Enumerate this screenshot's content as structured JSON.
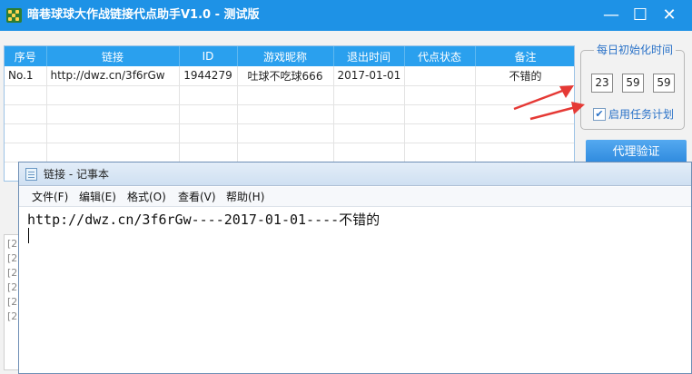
{
  "app": {
    "title": "暗巷球球大作战链接代点助手V1.0 - 测试版",
    "controls": {
      "minimize": "—",
      "maximize": "☐",
      "close": "✕"
    }
  },
  "table": {
    "columns": [
      "序号",
      "链接",
      "ID",
      "游戏昵称",
      "退出时间",
      "代点状态",
      "备注"
    ],
    "rows": [
      [
        "No.1",
        "http://dwz.cn/3f6rGw",
        "1944279",
        "吐球不吃球666",
        "2017-01-01",
        "",
        "不错的"
      ]
    ]
  },
  "init_time": {
    "title": "每日初始化时间",
    "hour": "23",
    "minute": "59",
    "second": "59",
    "task_label": "启用任务计划",
    "task_checked": true
  },
  "buttons": {
    "proxy_verify": "代理验证"
  },
  "log": {
    "prefix": "[2"
  },
  "notepad": {
    "title": "链接 - 记事本",
    "menus": [
      "文件(F)",
      "编辑(E)",
      "格式(O)",
      "查看(V)",
      "帮助(H)"
    ],
    "content": "http://dwz.cn/3f6rGw----2017-01-01----不错的"
  },
  "colors": {
    "titlebar": "#1e92e6",
    "table_header": "#2aa0ee",
    "accent_text": "#2a72c8",
    "arrow": "#e53935"
  }
}
